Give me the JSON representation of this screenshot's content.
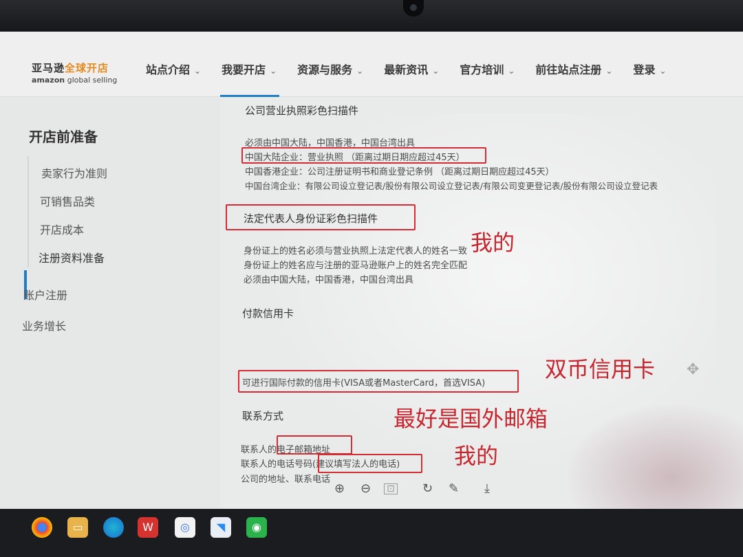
{
  "header": {
    "logo_cn_part1": "亚马逊",
    "logo_cn_part2": "全球开店",
    "logo_en_part1": "amazon",
    "logo_en_part2": "global selling",
    "nav": [
      {
        "label": "站点介绍"
      },
      {
        "label": "我要开店"
      },
      {
        "label": "资源与服务"
      },
      {
        "label": "最新资讯"
      },
      {
        "label": "官方培训"
      },
      {
        "label": "前往站点注册"
      },
      {
        "label": "登录"
      }
    ]
  },
  "sidebar": {
    "title": "开店前准备",
    "sub_items": [
      "卖家行为准则",
      "可销售品类",
      "开店成本",
      "注册资料准备"
    ],
    "sections": [
      "账户注册",
      "业务增长"
    ]
  },
  "content": {
    "license_title": "公司营业执照彩色扫描件",
    "license_lines": [
      "必须由中国大陆，中国香港，中国台湾出具",
      "中国大陆企业：营业执照 （距离过期日期应超过45天）",
      "中国香港企业：公司注册证明书和商业登记条例 （距离过期日期应超过45天）",
      "中国台湾企业：有限公司设立登记表/股份有限公司设立登记表/有限公司变更登记表/股份有限公司设立登记表"
    ],
    "id_title": "法定代表人身份证彩色扫描件",
    "id_lines": [
      "身份证上的姓名必须与营业执照上法定代表人的姓名一致",
      "身份证上的姓名应与注册的亚马逊账户上的姓名完全匹配",
      "必须由中国大陆，中国香港，中国台湾出具"
    ],
    "card_title": "付款信用卡",
    "card_line": "可进行国际付款的信用卡(VISA或者MasterCard，首选VISA)",
    "contact_title": "联系方式",
    "contact_lines": [
      "联系人的电子邮箱地址",
      "联系人的电话号码(建议填写法人的电话)",
      "公司的地址、联系电话"
    ]
  },
  "annotations": {
    "note_mine_1": "我的",
    "note_dual_card": "双币信用卡",
    "note_foreign_email": "最好是国外邮箱",
    "note_mine_2": "我的"
  },
  "colors": {
    "accent_blue": "#1d7cc7",
    "annotation_red": "#d42b35",
    "logo_orange": "#e58a1f"
  },
  "icons": {
    "pdf_toolbar": [
      "zoom-in-icon",
      "zoom-out-icon",
      "page-fit-icon",
      "rotate-icon",
      "pen-icon",
      "download-icon"
    ],
    "taskbar": [
      "chrome-icon",
      "file-explorer-icon",
      "edge-icon",
      "wps-icon",
      "photos-icon",
      "feishu-icon",
      "wechat-icon"
    ]
  }
}
